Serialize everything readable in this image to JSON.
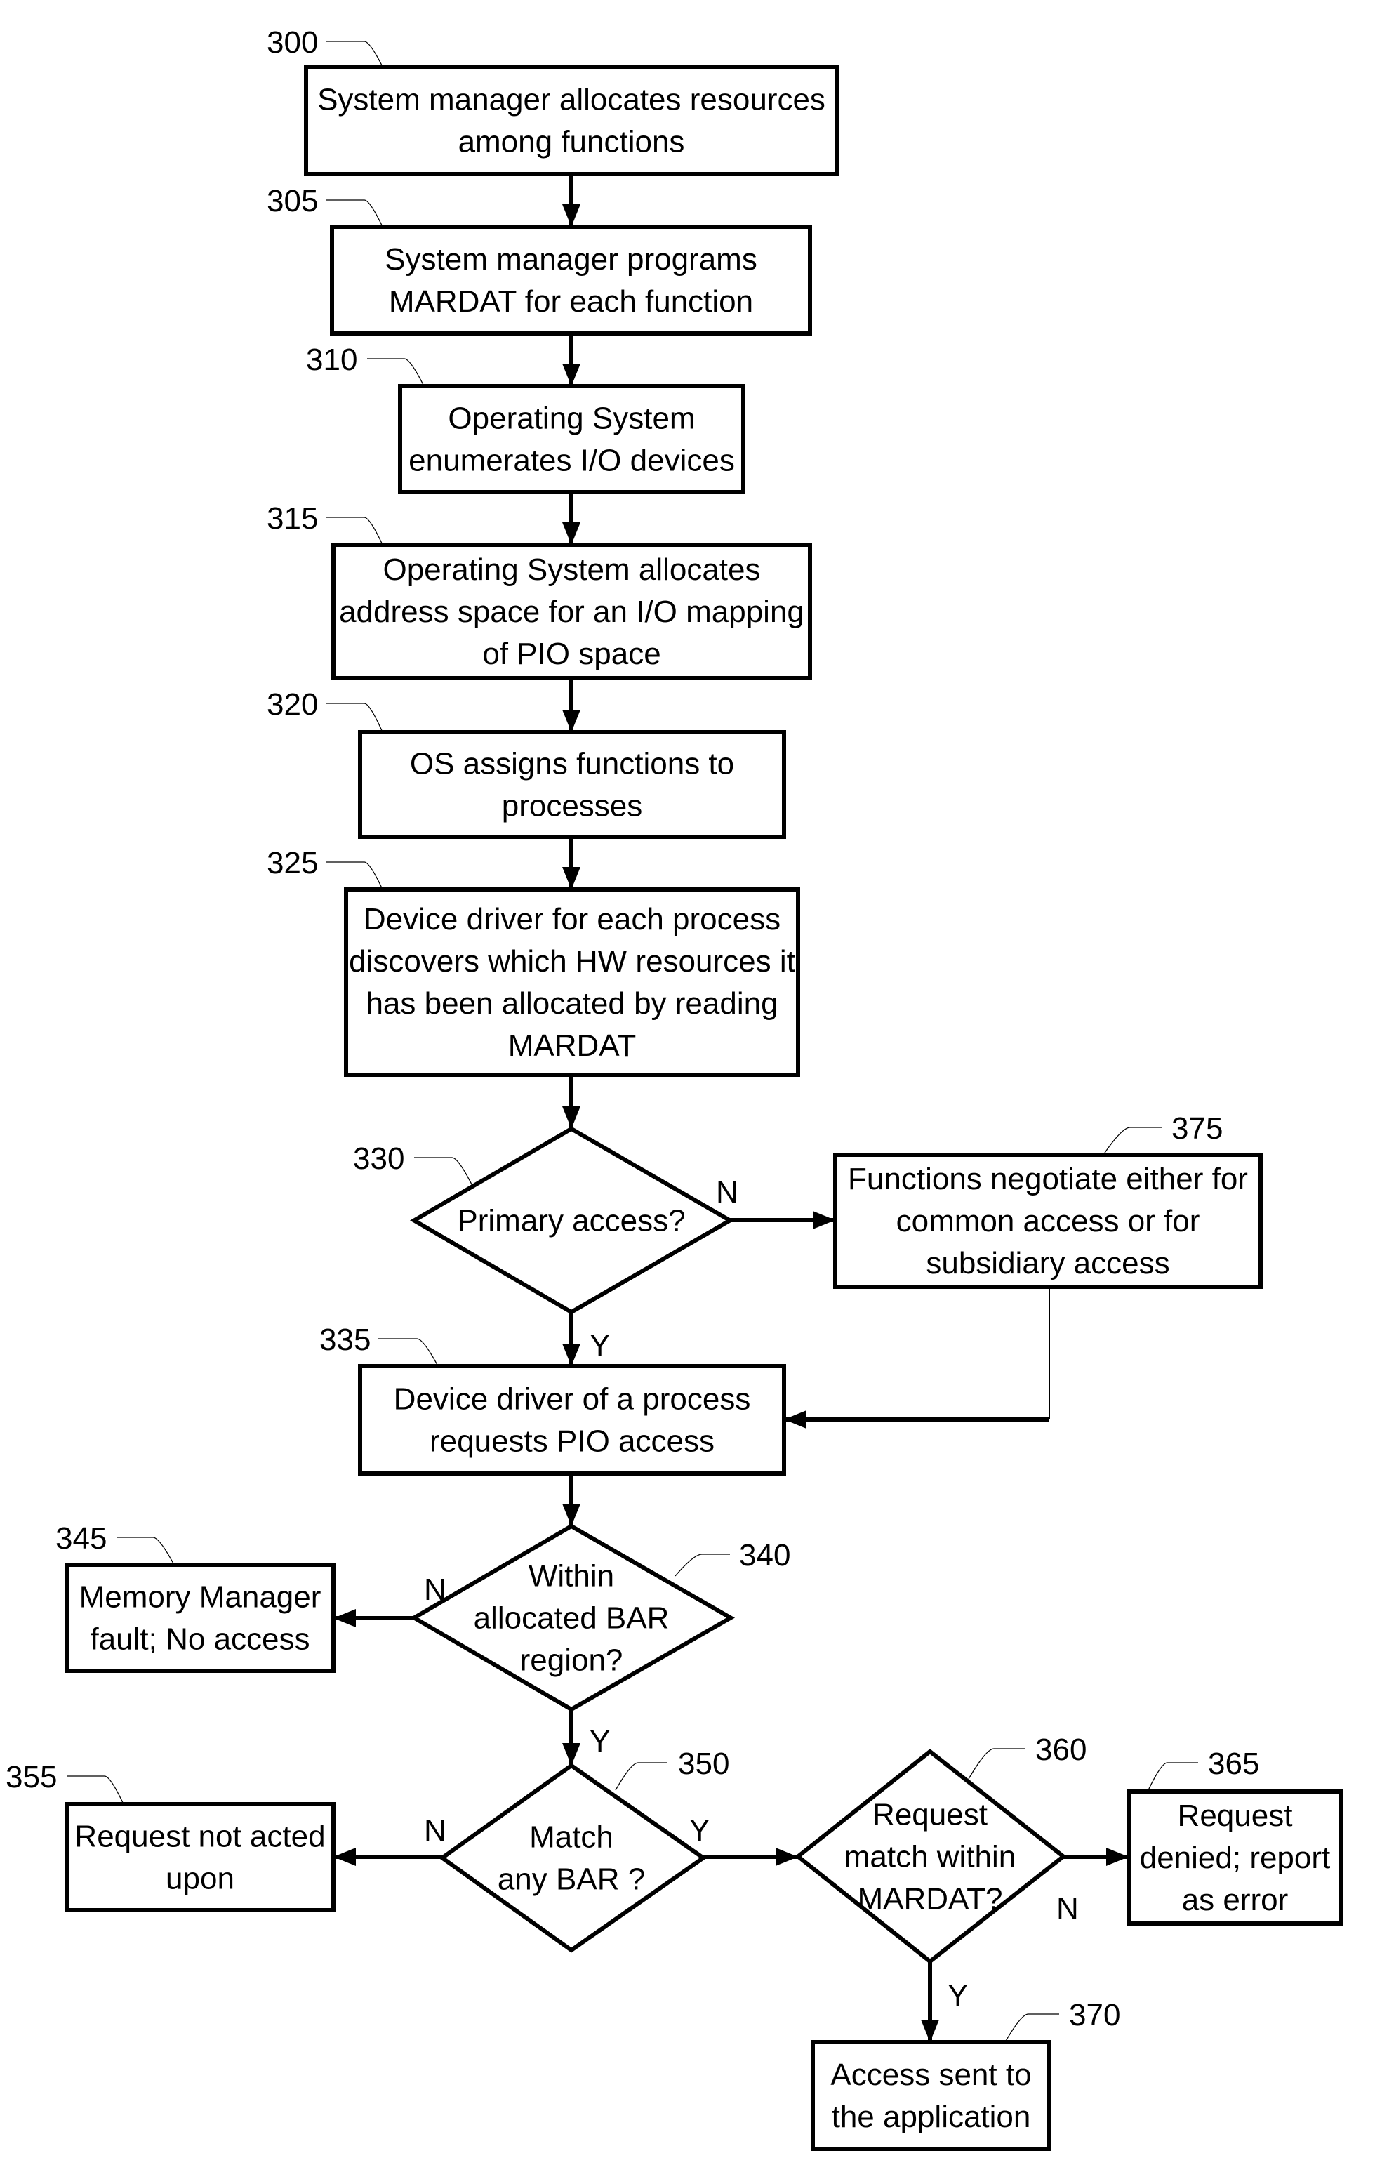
{
  "diagram": {
    "type": "flowchart",
    "nodes": [
      {
        "id": "300",
        "shape": "process",
        "ref": "300",
        "lines": [
          "System manager allocates resources",
          "among functions"
        ]
      },
      {
        "id": "305",
        "shape": "process",
        "ref": "305",
        "lines": [
          "System manager programs",
          "MARDAT for each function"
        ]
      },
      {
        "id": "310",
        "shape": "process",
        "ref": "310",
        "lines": [
          "Operating System",
          "enumerates I/O devices"
        ]
      },
      {
        "id": "315",
        "shape": "process",
        "ref": "315",
        "lines": [
          "Operating System allocates",
          "address space for an I/O mapping",
          "of PIO space"
        ]
      },
      {
        "id": "320",
        "shape": "process",
        "ref": "320",
        "lines": [
          "OS assigns functions to",
          "processes"
        ]
      },
      {
        "id": "325",
        "shape": "process",
        "ref": "325",
        "lines": [
          "Device driver for each process",
          "discovers which HW resources it",
          "has been allocated by reading",
          "MARDAT"
        ]
      },
      {
        "id": "330",
        "shape": "decision",
        "ref": "330",
        "lines": [
          "Primary access?"
        ]
      },
      {
        "id": "375",
        "shape": "process",
        "ref": "375",
        "lines": [
          "Functions negotiate either for",
          "common access or for",
          "subsidiary access"
        ]
      },
      {
        "id": "335",
        "shape": "process",
        "ref": "335",
        "lines": [
          "Device driver of a process",
          "requests PIO access"
        ]
      },
      {
        "id": "340",
        "shape": "decision",
        "ref": "340",
        "lines": [
          "Within",
          "allocated BAR",
          "region?"
        ]
      },
      {
        "id": "345",
        "shape": "process",
        "ref": "345",
        "lines": [
          "Memory Manager",
          "fault; No access"
        ]
      },
      {
        "id": "350",
        "shape": "decision",
        "ref": "350",
        "lines": [
          "Match",
          "any BAR ?"
        ]
      },
      {
        "id": "355",
        "shape": "process",
        "ref": "355",
        "lines": [
          "Request not acted",
          "upon"
        ]
      },
      {
        "id": "360",
        "shape": "decision",
        "ref": "360",
        "lines": [
          "Request",
          "match within",
          "MARDAT?"
        ]
      },
      {
        "id": "365",
        "shape": "process",
        "ref": "365",
        "lines": [
          "Request",
          "denied; report",
          "as error"
        ]
      },
      {
        "id": "370",
        "shape": "process",
        "ref": "370",
        "lines": [
          "Access sent to",
          "the application"
        ]
      }
    ],
    "edges": [
      {
        "from": "300",
        "to": "305",
        "label": ""
      },
      {
        "from": "305",
        "to": "310",
        "label": ""
      },
      {
        "from": "310",
        "to": "315",
        "label": ""
      },
      {
        "from": "315",
        "to": "320",
        "label": ""
      },
      {
        "from": "320",
        "to": "325",
        "label": ""
      },
      {
        "from": "325",
        "to": "330",
        "label": ""
      },
      {
        "from": "330",
        "to": "375",
        "label": "N"
      },
      {
        "from": "330",
        "to": "335",
        "label": "Y"
      },
      {
        "from": "375",
        "to": "335",
        "label": ""
      },
      {
        "from": "335",
        "to": "340",
        "label": ""
      },
      {
        "from": "340",
        "to": "345",
        "label": "N"
      },
      {
        "from": "340",
        "to": "350",
        "label": "Y"
      },
      {
        "from": "350",
        "to": "355",
        "label": "N"
      },
      {
        "from": "350",
        "to": "360",
        "label": "Y"
      },
      {
        "from": "360",
        "to": "365",
        "label": "N"
      },
      {
        "from": "360",
        "to": "370",
        "label": "Y"
      }
    ]
  }
}
